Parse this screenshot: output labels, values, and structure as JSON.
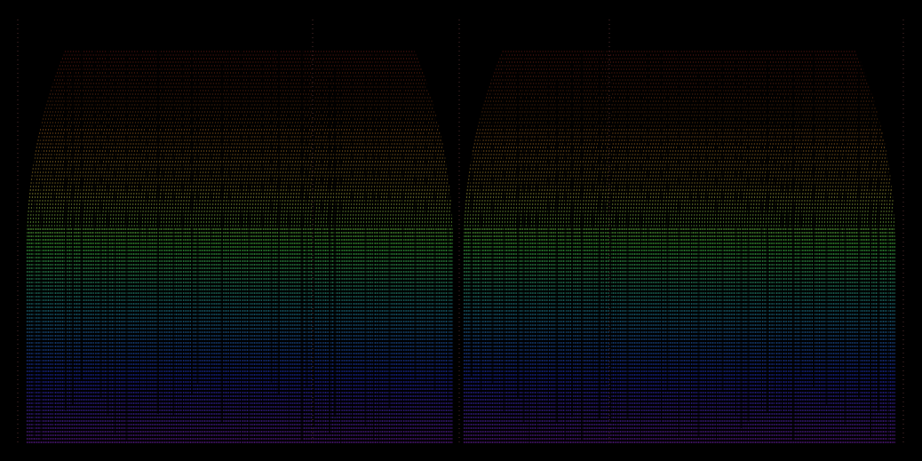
{
  "visualization": {
    "kind": "spectral-dot-pattern",
    "background_color": "#000000",
    "palette": [
      "#ff3b2a",
      "#ff8a2a",
      "#ffd54a",
      "#58ff58",
      "#2aa8c8",
      "#2a3cff",
      "#8a2ad8"
    ],
    "blocks": 2,
    "dome_shaped_envelope": true,
    "vertical_gaps_present": true
  }
}
